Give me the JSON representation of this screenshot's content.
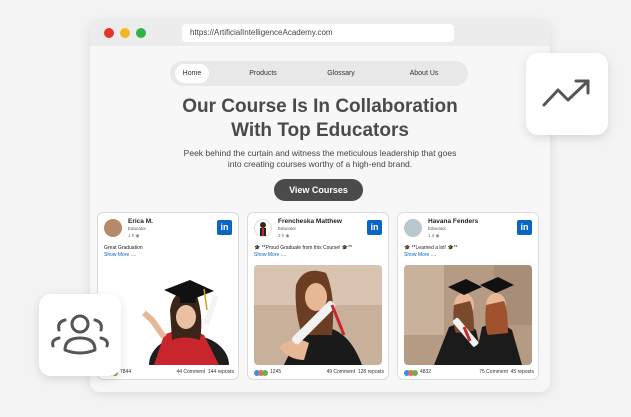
{
  "browser": {
    "url": "https://ArtificialIntelligenceAcademy.com"
  },
  "nav": {
    "items": [
      "Home",
      "Products",
      "Glossary",
      "About Us"
    ],
    "active": "Home"
  },
  "hero": {
    "title_line1": "Our Course Is In Collaboration",
    "title_line2": "With Top Educators",
    "subtitle_line1": "Peek behind the curtain and witness the meticulous leadership that goes",
    "subtitle_line2": "into creating courses worthy of a high-end brand.",
    "cta": "View Courses"
  },
  "cards": [
    {
      "name": "Erica M.",
      "role": "Educator",
      "meta": "1 h",
      "post": "Great Graduation",
      "more": "Show More ....",
      "reactions": "7844",
      "comments": "44 Comment",
      "reposts": "144 reposts"
    },
    {
      "name": "Frencheska Matthew",
      "role": "Educator",
      "meta": "3 h",
      "post": "🎓 **Proud Graduate from this Course! 🎓**",
      "more": "Show More ....",
      "reactions": "1245",
      "comments": "49 Comment",
      "reposts": "128 reposts"
    },
    {
      "name": "Havana Fenders",
      "role": "Educator",
      "meta": "1 d",
      "post": "🎓 **Learned a lot! 🎓**",
      "more": "Show More ....",
      "reactions": "4832",
      "comments": "75 Comment",
      "reposts": "45 reposts"
    }
  ],
  "icons": {
    "linkedin": "linkedin-icon",
    "trend": "trending-up-icon",
    "users": "users-icon",
    "globe": "globe-icon"
  },
  "colors": {
    "linkedin": "#0a66c2",
    "cta": "#4b4b4b",
    "close": "#e6332a",
    "minimize": "#f2b824",
    "maximize": "#2fb24a"
  }
}
